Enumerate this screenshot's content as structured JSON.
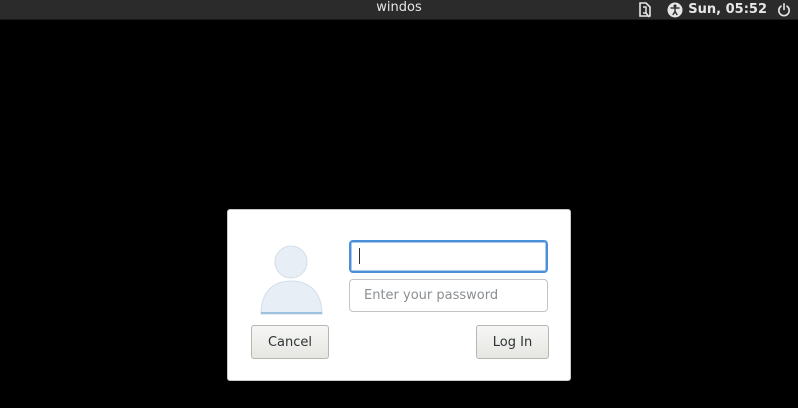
{
  "topbar": {
    "title": "windos",
    "clock": "Sun, 05:52",
    "icons": [
      "keyboard-layout-icon",
      "accessibility-icon",
      "power-icon"
    ]
  },
  "login_dialog": {
    "username_value": "",
    "password_placeholder": "Enter your password",
    "cancel_label": "Cancel",
    "login_label": "Log In"
  },
  "colors": {
    "background": "#000000",
    "topbar": "#2b2b2b",
    "focus_ring": "#4a90d9",
    "avatar": "#e7eef6"
  }
}
